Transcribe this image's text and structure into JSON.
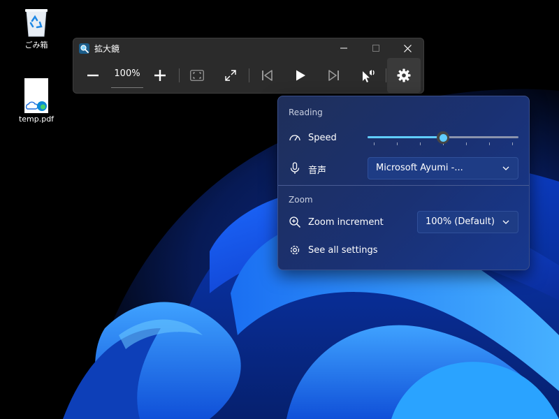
{
  "desktop": {
    "recycle_bin_label": "ごみ箱",
    "pdf_label": "temp.pdf"
  },
  "window": {
    "title": "拡大鏡",
    "app_icon": "magnifier-icon",
    "caption_icons": [
      "minimize-icon",
      "maximize-icon",
      "close-icon"
    ]
  },
  "toolbar": {
    "zoom_value": "100%",
    "icons": [
      "zoom-out-icon",
      "zoom-in-icon",
      "view-fullscreen-icon",
      "resize-icon",
      "previous-icon",
      "play-icon",
      "next-icon",
      "read-from-pointer-icon",
      "settings-icon"
    ]
  },
  "flyout": {
    "reading_header": "Reading",
    "speed_label": "Speed",
    "speed_fraction": 0.5,
    "speed_ticks": 7,
    "voice_label": "音声",
    "voice_value": "Microsoft Ayumi -...",
    "zoom_header": "Zoom",
    "zoom_increment_label": "Zoom increment",
    "zoom_increment_value": "100% (Default)",
    "see_all_settings": "See all settings"
  },
  "colors": {
    "accent": "#60cdff",
    "window_bg": "#2b2b2b",
    "flyout_bg": "#1a3173"
  }
}
